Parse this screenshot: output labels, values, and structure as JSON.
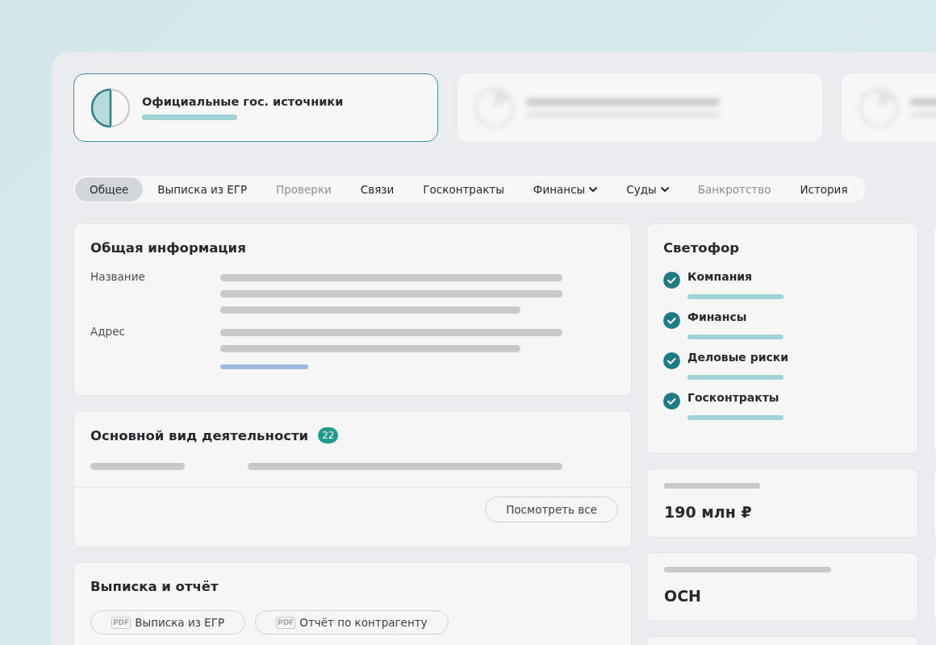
{
  "sources": [
    {
      "kind": "official",
      "title": "Официальные гос. источники",
      "selected": true
    },
    {
      "kind": "blurred",
      "selected": false
    },
    {
      "kind": "blurred",
      "selected": false
    }
  ],
  "tabs": [
    {
      "label": "Общее",
      "selected": true,
      "disabled": false,
      "dropdown": false
    },
    {
      "label": "Выписка из ЕГР",
      "selected": false,
      "disabled": false,
      "dropdown": false
    },
    {
      "label": "Проверки",
      "selected": false,
      "disabled": true,
      "dropdown": false
    },
    {
      "label": "Связи",
      "selected": false,
      "disabled": false,
      "dropdown": false
    },
    {
      "label": "Госконтракты",
      "selected": false,
      "disabled": false,
      "dropdown": false
    },
    {
      "label": "Финансы",
      "selected": false,
      "disabled": false,
      "dropdown": true
    },
    {
      "label": "Суды",
      "selected": false,
      "disabled": false,
      "dropdown": true
    },
    {
      "label": "Банкротство",
      "selected": false,
      "disabled": true,
      "dropdown": false
    },
    {
      "label": "История",
      "selected": false,
      "disabled": false,
      "dropdown": false
    }
  ],
  "general_info": {
    "title": "Общая информация",
    "fields": [
      {
        "label": "Название"
      },
      {
        "label": "Адрес"
      }
    ]
  },
  "activity": {
    "title": "Основной вид деятельности",
    "count": "22",
    "button": "Посмотреть все"
  },
  "documents": {
    "title": "Выписка и отчёт",
    "buttons": [
      {
        "icon": "PDF",
        "label": "Выписка из ЕГР"
      },
      {
        "icon": "PDF",
        "label": "Отчёт по контрагенту"
      }
    ]
  },
  "traffic_light": {
    "title": "Светофор",
    "items": [
      {
        "label": "Компания",
        "checked": true
      },
      {
        "label": "Финансы",
        "checked": true
      },
      {
        "label": "Деловые риски",
        "checked": true
      },
      {
        "label": "Госконтракты",
        "checked": true
      }
    ]
  },
  "metrics": [
    {
      "value": "190 млн ₽"
    },
    {
      "value": "ОСН"
    }
  ]
}
